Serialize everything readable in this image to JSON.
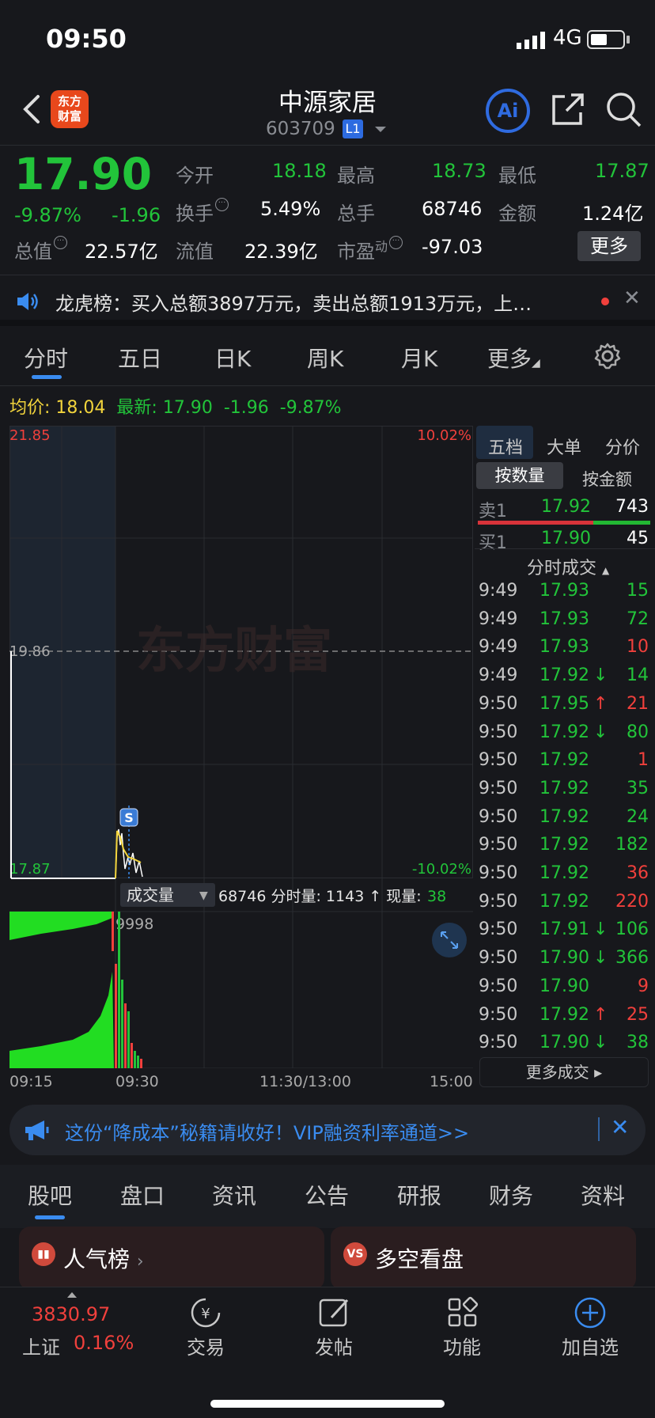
{
  "status": {
    "time": "09:50",
    "network": "4G"
  },
  "nav": {
    "stock_name": "中源家居",
    "stock_code": "603709",
    "level_badge": "L1",
    "ai_label": "Ai"
  },
  "quote": {
    "price": "17.90",
    "change_pct": "-9.87%",
    "change": "-1.96",
    "open_label": "今开",
    "open": "18.18",
    "high_label": "最高",
    "high": "18.73",
    "low_label": "最低",
    "low": "17.87",
    "turnover_label": "换手",
    "turnover": "5.49%",
    "volume_label": "总手",
    "volume": "68746",
    "amount_label": "金额",
    "amount": "1.24亿",
    "mktcap_label": "总值",
    "mktcap": "22.57亿",
    "float_label": "流值",
    "float": "22.39亿",
    "pe_label": "市盈",
    "pe_sup": "动",
    "pe": "-97.03",
    "more_label": "更多"
  },
  "news": {
    "text": "龙虎榜：买入总额3897万元，卖出总额1913万元，上…"
  },
  "period_tabs": [
    "分时",
    "五日",
    "日K",
    "周K",
    "月K",
    "更多"
  ],
  "avg": {
    "label": "均价:",
    "value": "18.04",
    "latest_label": "最新:",
    "latest": "17.90",
    "change": "-1.96",
    "pct": "-9.87%"
  },
  "chart": {
    "y_top": "21.85",
    "y_mid": "19.86",
    "y_bot": "17.87",
    "pct_top": "10.02%",
    "pct_bot": "-10.02%",
    "marker": "S",
    "watermark": "东方财富",
    "vol_select": "成交量",
    "vol_info_prefix": "68746 分时量: 1143 ↑ 现量:",
    "vol_now": "38",
    "vol_max": "9998",
    "x_labels": [
      "09:15",
      "09:30",
      "11:30/13:00",
      "15:00"
    ]
  },
  "orderbook": {
    "tabs": [
      "五档",
      "大单",
      "分价"
    ],
    "subtabs": [
      "按数量",
      "按金额"
    ],
    "sell1": {
      "label": "卖1",
      "price": "17.92",
      "vol": "743"
    },
    "buy1": {
      "label": "买1",
      "price": "17.90",
      "vol": "45"
    },
    "ticks_title": "分时成交",
    "ticks": [
      {
        "t": "9:49",
        "p": "17.93",
        "v": "15",
        "pc": "green",
        "vc": "green",
        "arrow": ""
      },
      {
        "t": "9:49",
        "p": "17.93",
        "v": "72",
        "pc": "green",
        "vc": "green",
        "arrow": ""
      },
      {
        "t": "9:49",
        "p": "17.93",
        "v": "10",
        "pc": "green",
        "vc": "red",
        "arrow": ""
      },
      {
        "t": "9:49",
        "p": "17.92",
        "v": "14",
        "pc": "green",
        "vc": "green",
        "arrow": "↓"
      },
      {
        "t": "9:50",
        "p": "17.95",
        "v": "21",
        "pc": "green",
        "vc": "red",
        "arrow": "↑"
      },
      {
        "t": "9:50",
        "p": "17.92",
        "v": "80",
        "pc": "green",
        "vc": "green",
        "arrow": "↓"
      },
      {
        "t": "9:50",
        "p": "17.92",
        "v": "1",
        "pc": "green",
        "vc": "red",
        "arrow": ""
      },
      {
        "t": "9:50",
        "p": "17.92",
        "v": "35",
        "pc": "green",
        "vc": "green",
        "arrow": ""
      },
      {
        "t": "9:50",
        "p": "17.92",
        "v": "24",
        "pc": "green",
        "vc": "green",
        "arrow": ""
      },
      {
        "t": "9:50",
        "p": "17.92",
        "v": "182",
        "pc": "green",
        "vc": "green",
        "arrow": ""
      },
      {
        "t": "9:50",
        "p": "17.92",
        "v": "36",
        "pc": "green",
        "vc": "red",
        "arrow": ""
      },
      {
        "t": "9:50",
        "p": "17.92",
        "v": "220",
        "pc": "green",
        "vc": "red",
        "arrow": ""
      },
      {
        "t": "9:50",
        "p": "17.91",
        "v": "106",
        "pc": "green",
        "vc": "green",
        "arrow": "↓"
      },
      {
        "t": "9:50",
        "p": "17.90",
        "v": "366",
        "pc": "green",
        "vc": "green",
        "arrow": "↓"
      },
      {
        "t": "9:50",
        "p": "17.90",
        "v": "9",
        "pc": "green",
        "vc": "red",
        "arrow": ""
      },
      {
        "t": "9:50",
        "p": "17.92",
        "v": "25",
        "pc": "green",
        "vc": "red",
        "arrow": "↑"
      },
      {
        "t": "9:50",
        "p": "17.90",
        "v": "38",
        "pc": "green",
        "vc": "green",
        "arrow": "↓"
      }
    ],
    "more_ticks": "更多成交"
  },
  "promo": {
    "text": "这份“降成本”秘籍请收好！VIP融资利率通道>>"
  },
  "bottom_tabs": [
    "股吧",
    "盘口",
    "资讯",
    "公告",
    "研报",
    "财务",
    "资料"
  ],
  "cards": {
    "popular": "人气榜",
    "longshort": "多空看盘",
    "longshort_icon": "VS"
  },
  "footer": {
    "index_value": "3830.97",
    "index_name": "上证",
    "index_pct": "0.16%",
    "items": [
      "交易",
      "发帖",
      "功能",
      "加自选"
    ]
  },
  "colors": {
    "up": "#f0403c",
    "down": "#22c43a",
    "accent": "#3a8cf0",
    "avg": "#f2d43c"
  }
}
